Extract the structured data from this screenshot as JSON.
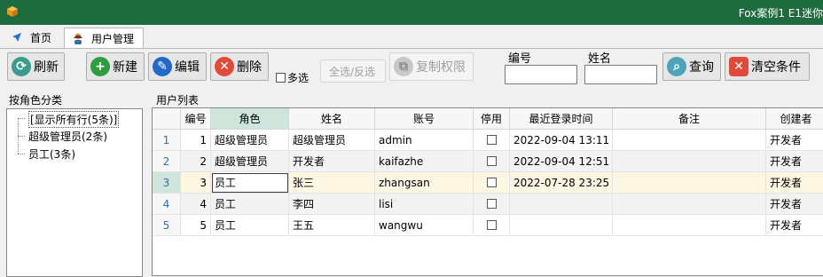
{
  "window": {
    "title": "Fox案例1 E1迷你"
  },
  "tabs": [
    {
      "label": "首页",
      "icon": "navigate-icon"
    },
    {
      "label": "用户管理",
      "icon": "user-group-icon"
    }
  ],
  "toolbar": {
    "refresh": "刷新",
    "new": "新建",
    "edit": "编辑",
    "delete": "删除",
    "multi_select": "多选",
    "select_all": "全选/反选",
    "copy_perm": "复制权限",
    "filter_id_label": "编号",
    "filter_name_label": "姓名",
    "query": "查询",
    "clear": "清空条件"
  },
  "left": {
    "title": "按角色分类",
    "items": [
      "[显示所有行(5条)]",
      "超级管理员(2条)",
      "员工(3条)"
    ]
  },
  "grid": {
    "title": "用户列表",
    "columns": [
      "编号",
      "角色",
      "姓名",
      "账号",
      "停用",
      "最近登录时间",
      "备注",
      "创建者"
    ],
    "rows": [
      {
        "rn": "1",
        "id": "1",
        "role": "超级管理员",
        "name": "超级管理员",
        "account": "admin",
        "last_login": "2022-09-04 13:11",
        "note": "",
        "creator": "开发者"
      },
      {
        "rn": "2",
        "id": "2",
        "role": "超级管理员",
        "name": "开发者",
        "account": "kaifazhe",
        "last_login": "2022-09-04 12:51",
        "note": "",
        "creator": "开发者"
      },
      {
        "rn": "3",
        "id": "3",
        "role": "员工",
        "name": "张三",
        "account": "zhangsan",
        "last_login": "2022-07-28 23:25",
        "note": "",
        "creator": "开发者"
      },
      {
        "rn": "4",
        "id": "4",
        "role": "员工",
        "name": "李四",
        "account": "lisi",
        "last_login": "",
        "note": "",
        "creator": "开发者"
      },
      {
        "rn": "5",
        "id": "5",
        "role": "员工",
        "name": "王五",
        "account": "wangwu",
        "last_login": "",
        "note": "",
        "creator": "开发者"
      }
    ]
  },
  "colors": {
    "titlebar": "#1e6b3f",
    "accent": "#cfe4da"
  }
}
